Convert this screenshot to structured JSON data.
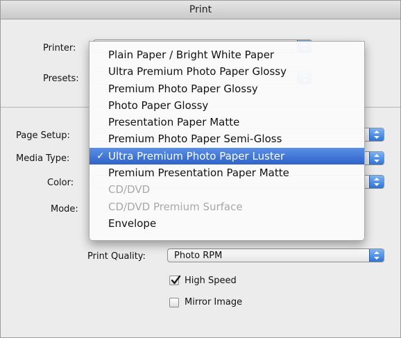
{
  "window": {
    "title": "Print"
  },
  "printer": {
    "label": "Printer:"
  },
  "presets": {
    "label": "Presets:"
  },
  "page_setup": {
    "label": "Page Setup:"
  },
  "media_type": {
    "label": "Media Type:",
    "options": [
      {
        "label": "Plain Paper / Bright White Paper",
        "state": "enabled"
      },
      {
        "label": "Ultra Premium Photo Paper Glossy",
        "state": "enabled"
      },
      {
        "label": "Premium Photo Paper Glossy",
        "state": "enabled"
      },
      {
        "label": "Photo Paper Glossy",
        "state": "enabled"
      },
      {
        "label": "Presentation Paper Matte",
        "state": "enabled"
      },
      {
        "label": "Premium Photo Paper Semi-Gloss",
        "state": "enabled"
      },
      {
        "label": "Ultra Premium Photo Paper Luster",
        "state": "selected"
      },
      {
        "label": "Premium Presentation Paper Matte",
        "state": "enabled"
      },
      {
        "label": "CD/DVD",
        "state": "disabled"
      },
      {
        "label": "CD/DVD Premium Surface",
        "state": "disabled"
      },
      {
        "label": "Envelope",
        "state": "enabled"
      }
    ],
    "check_glyph": "✓"
  },
  "color": {
    "label": "Color:"
  },
  "mode": {
    "label": "Mode:"
  },
  "print_quality": {
    "label": "Print Quality:",
    "value": "Photo RPM"
  },
  "high_speed": {
    "label": "High Speed",
    "checked": true
  },
  "mirror_image": {
    "label": "Mirror Image",
    "checked": false
  },
  "colors": {
    "accent": "#2f63c8",
    "arrow_button": "#3a7de0"
  }
}
